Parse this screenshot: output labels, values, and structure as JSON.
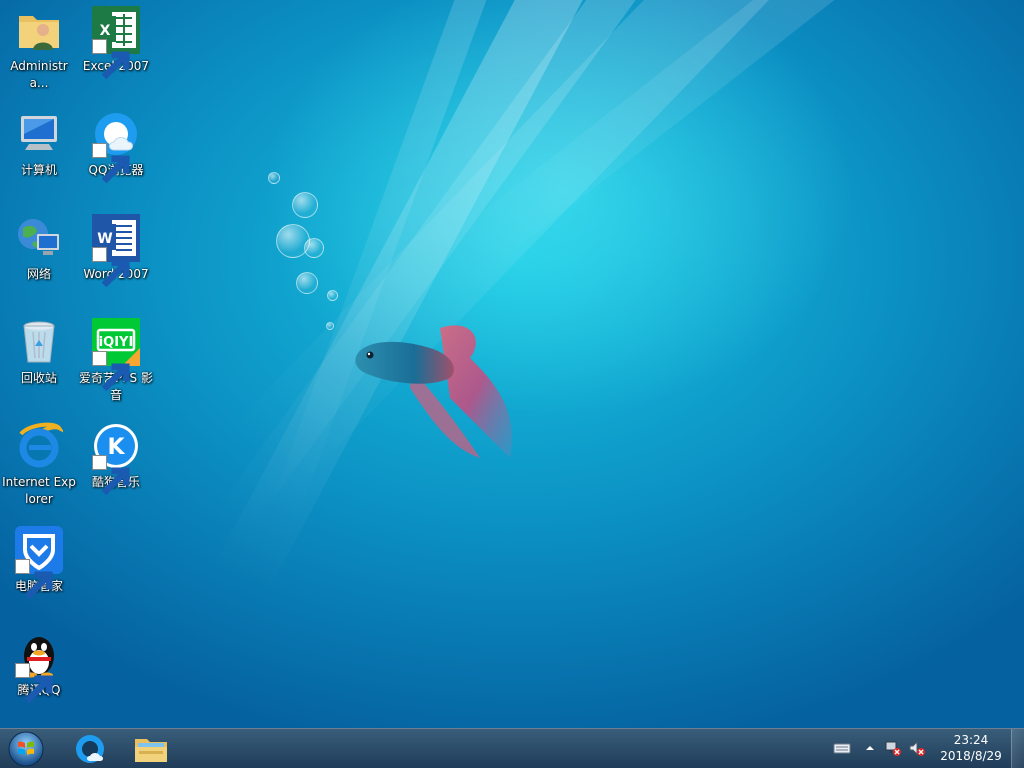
{
  "desktop": {
    "icons": [
      {
        "label": "Administra..."
      },
      {
        "label": "Excel 2007"
      },
      {
        "label": "计算机"
      },
      {
        "label": "QQ浏览器"
      },
      {
        "label": "网络"
      },
      {
        "label": "Word 2007"
      },
      {
        "label": "回收站"
      },
      {
        "label": "爱奇艺PPS 影音"
      },
      {
        "label": "Internet Explorer"
      },
      {
        "label": "酷狗音乐"
      },
      {
        "label": "电脑管家"
      },
      {
        "label": "腾讯QQ"
      }
    ]
  },
  "taskbar": {
    "apps": [
      "qq-browser-icon",
      "file-explorer-icon"
    ],
    "tray": [
      "keyboard-icon",
      "show-hidden-icons-chevron",
      "network-error-icon",
      "volume-muted-icon"
    ],
    "clock": {
      "time": "23:24",
      "date": "2018/8/29"
    }
  },
  "colors": {
    "accent": "#1fb4e0",
    "taskbar": "#1e4a6e"
  }
}
